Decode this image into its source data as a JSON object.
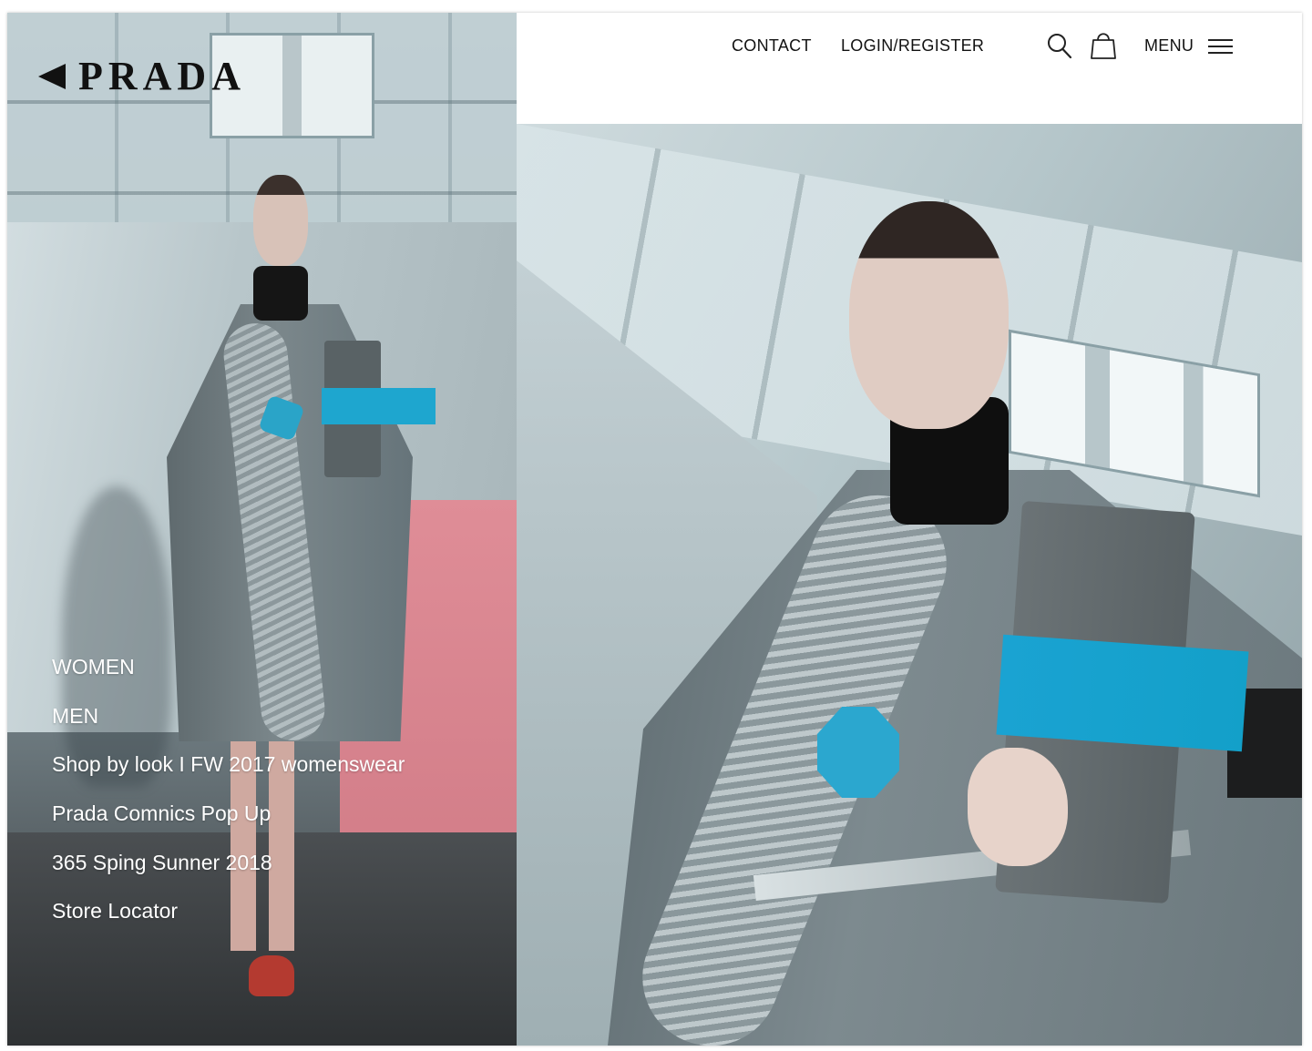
{
  "brand": {
    "logo_text": "PRADA"
  },
  "header": {
    "contact_label": "CONTACT",
    "login_label": "LOGIN/REGISTER",
    "menu_label": "MENU"
  },
  "side_nav": {
    "items": [
      {
        "label": "WOMEN"
      },
      {
        "label": "MEN"
      },
      {
        "label": "Shop by look I FW 2017 womenswear"
      },
      {
        "label": "Prada Comnics Pop Up"
      },
      {
        "label": "365 Sping Sunner 2018"
      },
      {
        "label": "Store Locator"
      }
    ]
  },
  "icons": {
    "search": "search-icon",
    "cart": "shopping-bag-icon",
    "menu": "hamburger-menu-icon"
  },
  "colors": {
    "accent_blue": "#1ea6cf",
    "pink_wall": "#d98893",
    "text_dark": "#111111",
    "text_light": "#ffffff"
  }
}
